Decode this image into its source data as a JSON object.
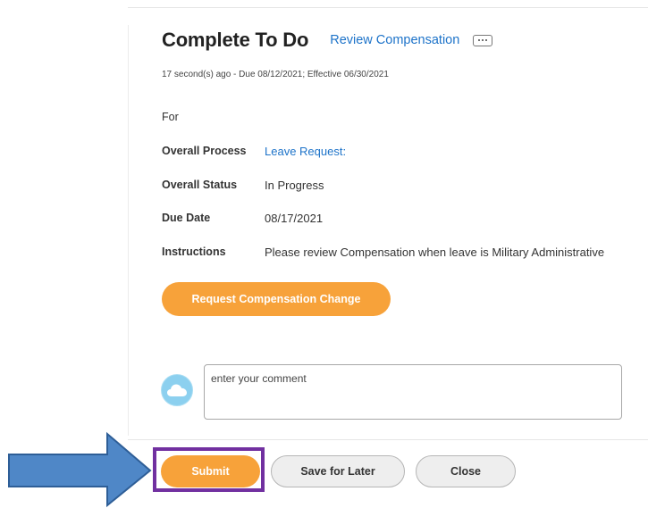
{
  "header": {
    "title": "Complete To Do",
    "task_link": "Review Compensation"
  },
  "subtitle": "17 second(s) ago - Due 08/12/2021; Effective 06/30/2021",
  "fields": {
    "for": {
      "label": "For",
      "value": ""
    },
    "overall_process": {
      "label": "Overall Process",
      "value": "Leave Request:"
    },
    "overall_status": {
      "label": "Overall Status",
      "value": "In Progress"
    },
    "due_date": {
      "label": "Due Date",
      "value": "08/17/2021"
    },
    "instructions": {
      "label": "Instructions",
      "value": "Please review Compensation when leave is Military Administrative"
    }
  },
  "actions": {
    "request_change_label": "Request Compensation Change"
  },
  "comment": {
    "placeholder": "enter your comment",
    "avatar_icon": "cloud-icon"
  },
  "footer": {
    "submit_label": "Submit",
    "save_label": "Save for Later",
    "close_label": "Close"
  },
  "annotations": {
    "arrow_icon": "arrow-right-icon",
    "highlight_color": "#7130a0",
    "arrow_color": "#4f87c7"
  },
  "colors": {
    "accent": "#f7a23a",
    "link": "#1d73c9"
  }
}
